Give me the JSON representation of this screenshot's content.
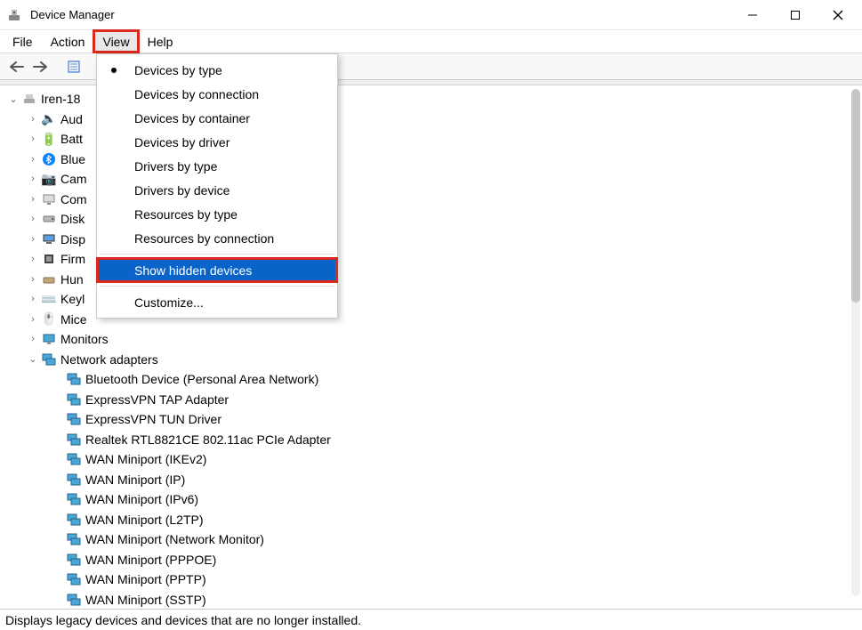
{
  "window": {
    "title": "Device Manager"
  },
  "menubar": {
    "file": "File",
    "action": "Action",
    "view": "View",
    "help": "Help"
  },
  "view_menu": {
    "devices_by_type": "Devices by type",
    "devices_by_connection": "Devices by connection",
    "devices_by_container": "Devices by container",
    "devices_by_driver": "Devices by driver",
    "drivers_by_type": "Drivers by type",
    "drivers_by_device": "Drivers by device",
    "resources_by_type": "Resources by type",
    "resources_by_connection": "Resources by connection",
    "show_hidden": "Show hidden devices",
    "customize": "Customize..."
  },
  "tree": {
    "root": "Iren-18",
    "categories": {
      "audio": "Aud",
      "batteries": "Batt",
      "bluetooth": "Blue",
      "cameras": "Cam",
      "computer": "Com",
      "disk": "Disk",
      "display": "Disp",
      "firmware": "Firm",
      "hid": "Hun",
      "keyboards": "Keyl",
      "mice": "Mice",
      "monitors": "Monitors",
      "network": "Network adapters"
    },
    "network_children": [
      "Bluetooth Device (Personal Area Network)",
      "ExpressVPN TAP Adapter",
      "ExpressVPN TUN Driver",
      "Realtek RTL8821CE 802.11ac PCIe Adapter",
      "WAN Miniport (IKEv2)",
      "WAN Miniport (IP)",
      "WAN Miniport (IPv6)",
      "WAN Miniport (L2TP)",
      "WAN Miniport (Network Monitor)",
      "WAN Miniport (PPPOE)",
      "WAN Miniport (PPTP)",
      "WAN Miniport (SSTP)"
    ]
  },
  "statusbar": {
    "text": "Displays legacy devices and devices that are no longer installed."
  }
}
